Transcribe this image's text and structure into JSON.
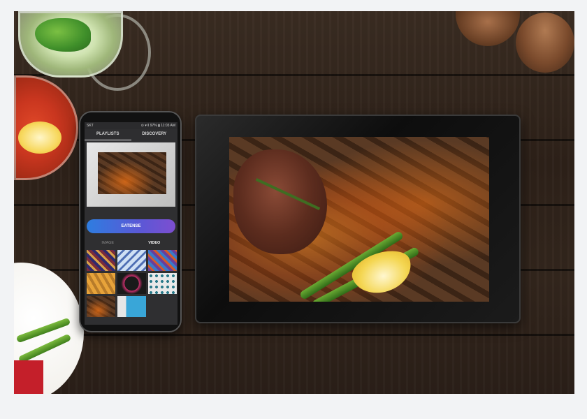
{
  "phone": {
    "status": {
      "carrier": "SKT",
      "right": "⊙ ▾ ‖ 97% ▮ 11:03 AM"
    },
    "tabs": [
      {
        "label": "PLAYLISTS",
        "active": true
      },
      {
        "label": "DISCOVERY",
        "active": false
      }
    ],
    "action_button": "EATENSE",
    "subtabs": [
      {
        "label": "IMAGE",
        "active": false
      },
      {
        "label": "VIDEO",
        "active": true
      }
    ],
    "thumbnail_count": 8
  },
  "colors": {
    "action_gradient_start": "#2e7de0",
    "action_gradient_end": "#7d4ed0",
    "background": "#f2f3f5"
  },
  "frame": {
    "content": "steak on embers with green beans and lemon"
  }
}
